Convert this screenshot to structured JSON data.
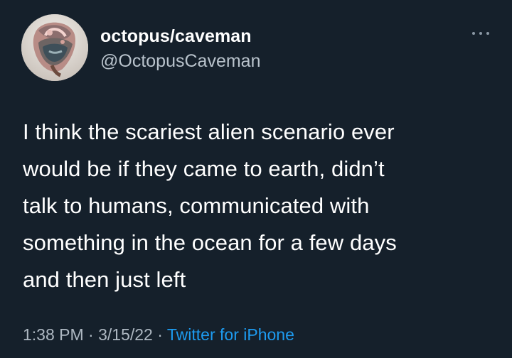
{
  "author": {
    "display_name": "octopus/caveman",
    "handle": "@OctopusCaveman",
    "avatar_icon": "profile-photo"
  },
  "menu": {
    "icon": "more-options-icon"
  },
  "tweet": {
    "text": "I think the scariest alien scenario ever\nwould be if they came to earth, didn’t\ntalk to humans, communicated with\nsomething in the ocean for a few days\nand then just left"
  },
  "metadata": {
    "time": "1:38 PM",
    "separator": "·",
    "date": "3/15/22",
    "source": "Twitter for iPhone"
  },
  "colors": {
    "background": "#15202b",
    "text": "#ffffff",
    "secondary": "#aeb8c2",
    "link": "#1d9bf0"
  }
}
